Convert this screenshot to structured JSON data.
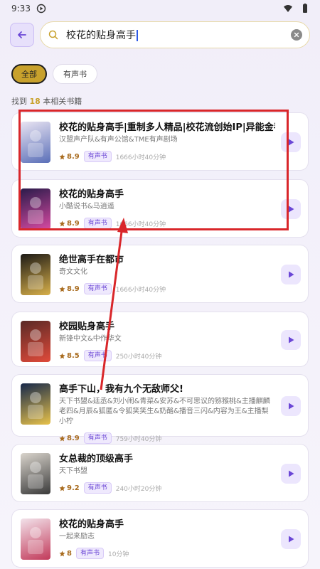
{
  "status_bar": {
    "time": "9:33"
  },
  "search": {
    "query": "校花的贴身高手"
  },
  "filters": [
    {
      "label": "全部",
      "active": true
    },
    {
      "label": "有声书",
      "active": false
    }
  ],
  "result_summary": {
    "prefix": "找到",
    "count": "18",
    "suffix": "本相关书籍"
  },
  "books": [
    {
      "title": "校花的贴身高手|重制多人精品|校花流创始IP|异能金手指",
      "author": "汉盟声产队&有声公馆&TME有声剧场",
      "rating": "8.9",
      "tag": "有声书",
      "duration": "1666小时40分钟",
      "cover_colors": [
        "#e9e4f2",
        "#5a6fb8"
      ]
    },
    {
      "title": "校花的贴身高手",
      "author": "小酷说书&马逍遥",
      "rating": "8.9",
      "tag": "有声书",
      "duration": "1666小时40分钟",
      "cover_colors": [
        "#2a1b4a",
        "#d84aa2"
      ]
    },
    {
      "title": "绝世高手在都市",
      "author": "奇文文化",
      "rating": "8.9",
      "tag": "有声书",
      "duration": "1666小时40分钟",
      "cover_colors": [
        "#1d1a16",
        "#d8b04a"
      ]
    },
    {
      "title": "校园贴身高手",
      "author": "新锋中文&中作华文",
      "rating": "8.5",
      "tag": "有声书",
      "duration": "250小时40分钟",
      "cover_colors": [
        "#5a2a26",
        "#e04a3a"
      ]
    },
    {
      "title": "高手下山，我有九个无敌师父!",
      "author": "天下书盟&廷丞&刘小闹&青菜&安苏&不可思议的猕猴桃&主播麒麟老四&月辰&狐匿&令狐笑笑生&奶酪&播音三闪&内容为王&主播梨小柠",
      "rating": "8.9",
      "tag": "有声书",
      "duration": "759小时40分钟",
      "cover_colors": [
        "#16284a",
        "#e8c24a"
      ]
    },
    {
      "title": "女总裁的顶级高手",
      "author": "天下书盟",
      "rating": "9.2",
      "tag": "有声书",
      "duration": "240小时20分钟",
      "cover_colors": [
        "#d9d4cc",
        "#3a3a3a"
      ]
    },
    {
      "title": "校花的贴身高手",
      "author": "一起来励志",
      "rating": "8",
      "tag": "有声书",
      "duration": "10分钟",
      "cover_colors": [
        "#f2e2ea",
        "#c23a5a"
      ]
    }
  ],
  "colors": {
    "accent_gold": "#c8a12c",
    "accent_purple": "#6b47d6",
    "highlight_red": "#d9262a"
  }
}
